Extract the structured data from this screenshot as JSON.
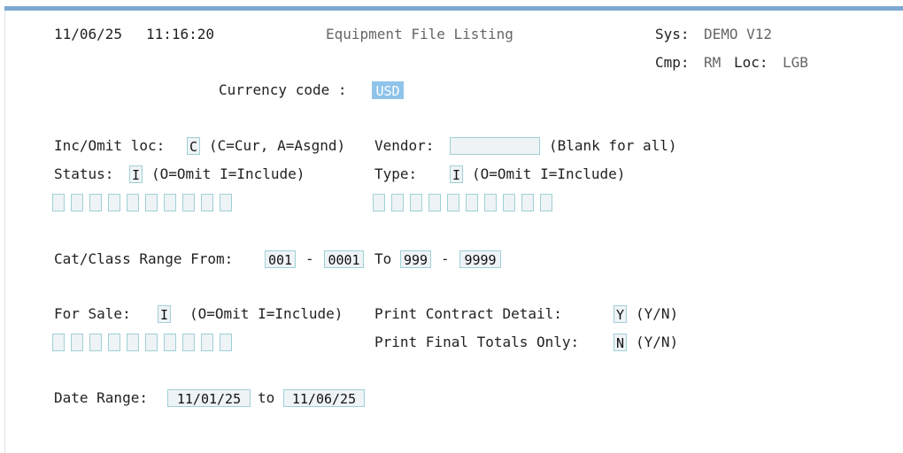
{
  "header": {
    "date": "11/06/25",
    "time": "11:16:20",
    "title": "Equipment File Listing",
    "sys_label": "Sys:",
    "sys_value": "DEMO V12",
    "cmp_label": "Cmp:",
    "cmp_value": "RM",
    "loc_label": "Loc:",
    "loc_value": "LGB"
  },
  "currency": {
    "label": "Currency code :",
    "value": "USD"
  },
  "inc_omit": {
    "label": "Inc/Omit loc:",
    "value": "C",
    "hint": "(C=Cur, A=Asgnd)"
  },
  "vendor": {
    "label": "Vendor:",
    "value": "",
    "hint": "(Blank for all)"
  },
  "status": {
    "label": "Status:",
    "value": "I",
    "hint": "(O=Omit I=Include)"
  },
  "type": {
    "label": "Type:",
    "value": "I",
    "hint": "(O=Omit I=Include)"
  },
  "range": {
    "label": "Cat/Class Range From:",
    "from_cat": "001",
    "dash": "-",
    "from_class": "0001",
    "to_label": "To",
    "to_cat": "999",
    "to_class": "9999"
  },
  "for_sale": {
    "label": "For Sale:",
    "value": "I",
    "hint": "(O=Omit I=Include)"
  },
  "print_contract": {
    "label": "Print Contract Detail:",
    "value": "Y",
    "hint": "(Y/N)"
  },
  "print_final": {
    "label": "Print Final Totals Only:",
    "value": "N",
    "hint": "(Y/N)"
  },
  "date_range": {
    "label": "Date Range:",
    "from": "11/01/25",
    "to_label": "to",
    "to": "11/06/25"
  },
  "colors": {
    "accent_bar": "#7ea8d3",
    "field_border": "#9fd0d5",
    "field_bg": "#eef3f6",
    "highlight": "#8ec3ea"
  }
}
